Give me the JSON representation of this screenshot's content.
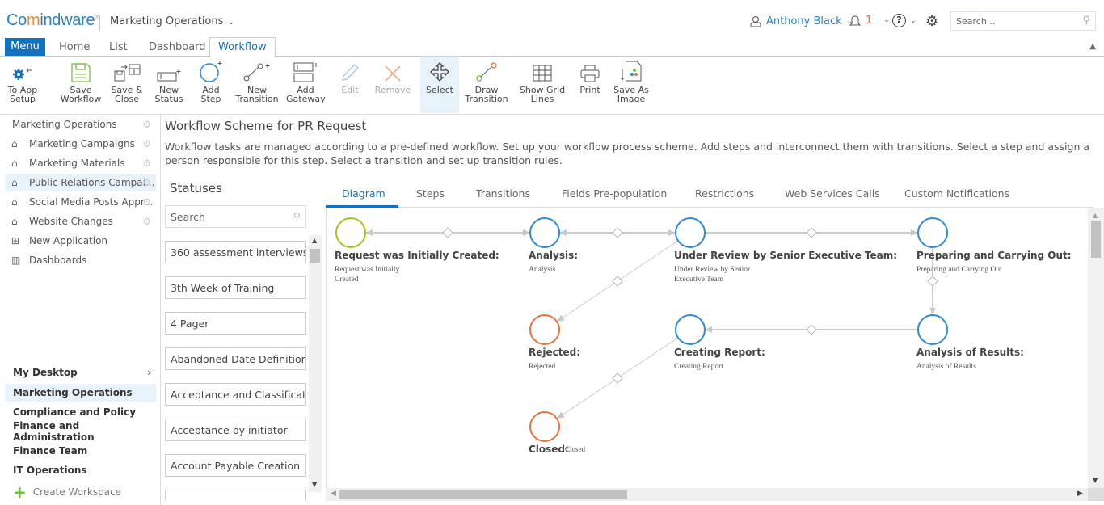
{
  "header": {
    "logo_prefix": "Co",
    "logo_accent": "m",
    "logo_rest": "indware",
    "logo_mark": "®",
    "workspace": "Marketing Operations",
    "user": "Anthony Black",
    "notifications": "1",
    "help": "?",
    "search_placeholder": "Search..."
  },
  "nav": {
    "menu": "Menu",
    "tabs": [
      "Home",
      "List",
      "Dashboard",
      "Workflow"
    ],
    "active": "Workflow"
  },
  "ribbon": [
    {
      "label1": "To App",
      "label2": "Setup",
      "icon": "gear-back-icon"
    },
    {
      "label1": "Save",
      "label2": "Workflow",
      "icon": "save-icon"
    },
    {
      "label1": "Save &",
      "label2": "Close",
      "icon": "save-close-icon"
    },
    {
      "label1": "New",
      "label2": "Status",
      "icon": "new-status-icon"
    },
    {
      "label1": "Add",
      "label2": "Step",
      "icon": "add-step-icon"
    },
    {
      "label1": "New",
      "label2": "Transition",
      "icon": "new-transition-icon"
    },
    {
      "label1": "Add",
      "label2": "Gateway",
      "icon": "add-gateway-icon"
    },
    {
      "label1": "Edit",
      "label2": "",
      "icon": "edit-icon",
      "disabled": true
    },
    {
      "label1": "Remove",
      "label2": "",
      "icon": "remove-icon",
      "disabled": true
    },
    {
      "label1": "Select",
      "label2": "",
      "icon": "select-icon",
      "selected": true
    },
    {
      "label1": "Draw",
      "label2": "Transition",
      "icon": "draw-transition-icon"
    },
    {
      "label1": "Show Grid",
      "label2": "Lines",
      "icon": "grid-icon"
    },
    {
      "label1": "Print",
      "label2": "",
      "icon": "print-icon"
    },
    {
      "label1": "Save As",
      "label2": "Image",
      "icon": "save-image-icon"
    }
  ],
  "sidebar": {
    "section": "Marketing Operations",
    "apps": [
      "Marketing Campaigns",
      "Marketing Materials",
      "Public Relations Campai...",
      "Social Media Posts Appr...",
      "Website Changes"
    ],
    "active_app": "Public Relations Campai...",
    "new_app": "New Application",
    "dashboards": "Dashboards",
    "workspaces": [
      "My Desktop",
      "Marketing Operations",
      "Compliance and Policy",
      "Finance and Administration",
      "Finance Team",
      "IT Operations"
    ],
    "active_workspace": "Marketing Operations",
    "create": "Create Workspace"
  },
  "page": {
    "title": "Workflow Scheme for PR Request",
    "description": "Workflow tasks are managed according to a pre-defined workflow. Set up your workflow process scheme. Add steps and interconnect them with transitions. Select a step and assign a person responsible for this step. Select a transition and set up transition rules."
  },
  "statuses": {
    "title": "Statuses",
    "search_placeholder": "Search",
    "items": [
      "360 assessment interviews",
      "3th Week of Training",
      "4 Pager",
      "Abandoned Date Definition",
      "Acceptance and Classificati...",
      "Acceptance by initiator",
      "Account Payable Creation"
    ]
  },
  "content_tabs": [
    "Diagram",
    "Steps",
    "Transitions",
    "Fields Pre-population",
    "Restrictions",
    "Web Services Calls",
    "Custom Notifications"
  ],
  "active_content_tab": "Diagram",
  "diagram": {
    "colors": {
      "start": "#a4c41c",
      "step": "#2d8ad6",
      "end": "#e8733e",
      "line": "#cccccc"
    },
    "nodes": [
      {
        "id": "n1",
        "name": "Request was Initially Created:",
        "desc": "Request was Initially Created",
        "type": "start"
      },
      {
        "id": "n2",
        "name": "Analysis:",
        "desc": "Analysis",
        "type": "step"
      },
      {
        "id": "n3",
        "name": "Under Review by Senior Executive Team:",
        "desc": "Under Review by Senior Executive Team",
        "type": "step"
      },
      {
        "id": "n4",
        "name": "Preparing and Carrying Out:",
        "desc": "Preparing and Carrying Out",
        "type": "step"
      },
      {
        "id": "n5",
        "name": "Rejected:",
        "desc": "Rejected",
        "type": "end"
      },
      {
        "id": "n6",
        "name": "Creating Report:",
        "desc": "Creating Report",
        "type": "step"
      },
      {
        "id": "n7",
        "name": "Analysis of Results:",
        "desc": "Analysis of Results",
        "type": "step"
      },
      {
        "id": "n8",
        "name": "Closed:",
        "desc": "Closed",
        "type": "end"
      }
    ],
    "transitions": [
      {
        "from": "n2",
        "to": "n1"
      },
      {
        "from": "n1",
        "to": "n2"
      },
      {
        "from": "n3",
        "to": "n2"
      },
      {
        "from": "n2",
        "to": "n3"
      },
      {
        "from": "n3",
        "to": "n4"
      },
      {
        "from": "n3",
        "to": "n5"
      },
      {
        "from": "n4",
        "to": "n7"
      },
      {
        "from": "n7",
        "to": "n6"
      },
      {
        "from": "n6",
        "to": "n8"
      }
    ]
  }
}
